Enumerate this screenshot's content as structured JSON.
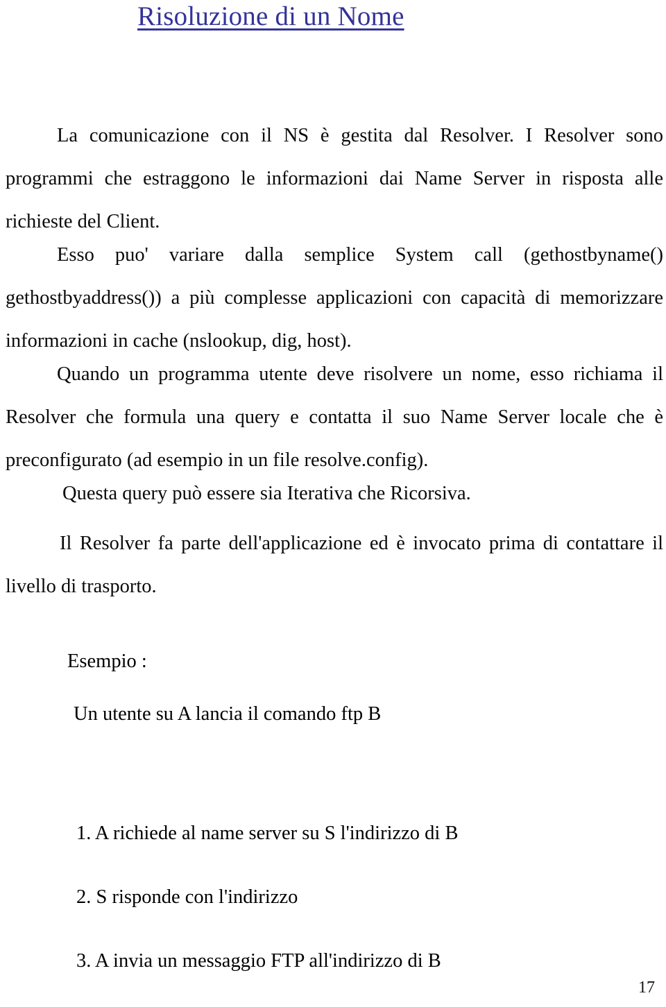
{
  "document": {
    "title": "Risoluzione di un Nome",
    "title_color": "#333399",
    "page_number": "17"
  },
  "paragraphs": {
    "p1": "La comunicazione con il NS è gestita dal Resolver. I Resolver sono programmi che estraggono le informazioni  dai Name Server in risposta alle richieste del Client.",
    "p2": "Esso puo' variare dalla semplice System call (gethostbyname() gethostbyaddress()) a  più complesse applicazioni con capacità di memorizzare informazioni in cache (nslookup, dig, host).",
    "p3": "Quando un programma utente deve risolvere un nome,  esso richiama il Resolver che formula una query e contatta il suo Name Server locale che è preconfigurato (ad esempio in un file resolve.config).",
    "p4": "Questa  query può essere sia Iterativa che Ricorsiva.",
    "p5": "Il  Resolver fa parte dell'applicazione ed è invocato prima di contattare il livello di trasporto."
  },
  "example": {
    "heading": "Esempio :",
    "intro": "Un utente su A lancia   il comando ftp B",
    "steps": [
      "1. A richiede al name server su S l'indirizzo di B",
      "2. S risponde con l'indirizzo",
      "3. A invia un messaggio FTP all'indirizzo di B"
    ]
  }
}
